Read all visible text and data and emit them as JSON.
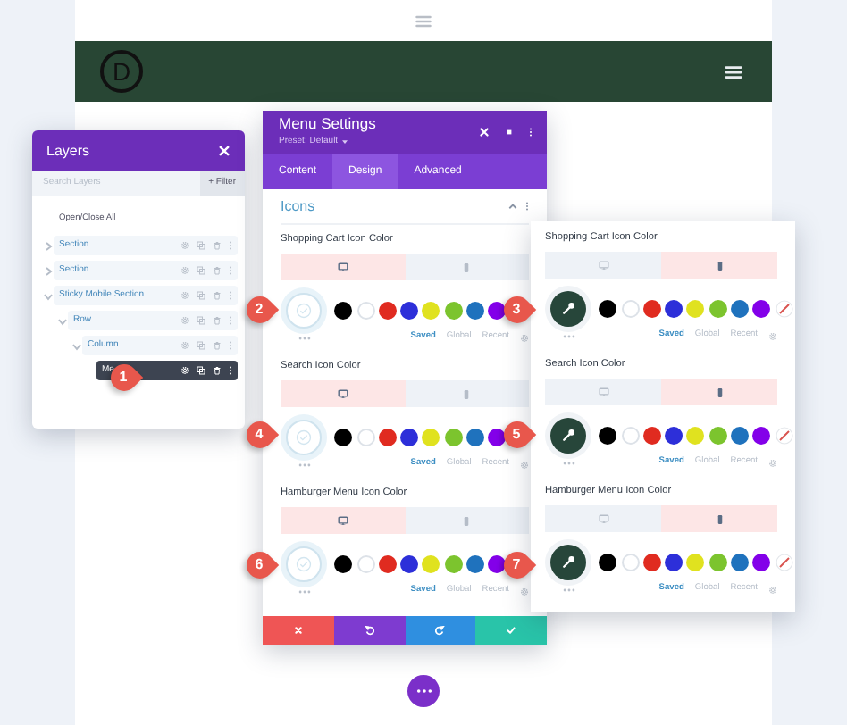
{
  "page": {
    "logo": "D"
  },
  "layers_panel": {
    "title": "Layers",
    "search": {
      "placeholder": "Search Layers"
    },
    "filter_button": "+ Filter",
    "toggle_all": "Open/Close All",
    "items": [
      {
        "label": "Section",
        "expanded": false,
        "selected": false
      },
      {
        "label": "Section",
        "expanded": false,
        "selected": false
      },
      {
        "label": "Sticky Mobile Section",
        "expanded": true,
        "selected": false,
        "children": [
          {
            "label": "Row",
            "expanded": true,
            "selected": false,
            "children": [
              {
                "label": "Column",
                "expanded": true,
                "selected": false,
                "children": [
                  {
                    "label": "Me",
                    "selected": true
                  }
                ]
              }
            ]
          }
        ]
      }
    ]
  },
  "settings_panel": {
    "title": "Menu Settings",
    "preset": "Preset: Default",
    "tabs": [
      {
        "label": "Content",
        "selected": false
      },
      {
        "label": "Design",
        "selected": true
      },
      {
        "label": "Advanced",
        "selected": false
      }
    ],
    "group": "Icons",
    "fields": [
      {
        "label": "Shopping Cart Icon Color",
        "devices": [
          {
            "kind": "desktop",
            "selected": true
          },
          {
            "kind": "phone",
            "selected": false
          }
        ],
        "swatches": [
          {
            "color": "#000000"
          },
          {
            "color": "#ffffff"
          },
          {
            "color": "#e02b20"
          },
          {
            "color": "#2d2fd9"
          },
          {
            "color": "#e0e21f"
          },
          {
            "color": "#7cc42e"
          },
          {
            "color": "#1f72bd"
          },
          {
            "color": "#8300e9"
          }
        ],
        "sources": [
          {
            "label": "Saved",
            "selected": true
          },
          {
            "label": "Global",
            "selected": false
          },
          {
            "label": "Recent",
            "selected": false
          }
        ]
      },
      {
        "label": "Search Icon Color",
        "devices": [
          {
            "kind": "desktop",
            "selected": true
          },
          {
            "kind": "phone",
            "selected": false
          }
        ],
        "swatches": [
          {
            "color": "#000000"
          },
          {
            "color": "#ffffff"
          },
          {
            "color": "#e02b20"
          },
          {
            "color": "#2d2fd9"
          },
          {
            "color": "#e0e21f"
          },
          {
            "color": "#7cc42e"
          },
          {
            "color": "#1f72bd"
          },
          {
            "color": "#8300e9"
          }
        ],
        "sources": [
          {
            "label": "Saved",
            "selected": true
          },
          {
            "label": "Global",
            "selected": false
          },
          {
            "label": "Recent",
            "selected": false
          }
        ]
      },
      {
        "label": "Hamburger Menu Icon Color",
        "devices": [
          {
            "kind": "desktop",
            "selected": true
          },
          {
            "kind": "phone",
            "selected": false
          }
        ],
        "swatches": [
          {
            "color": "#000000"
          },
          {
            "color": "#ffffff"
          },
          {
            "color": "#e02b20"
          },
          {
            "color": "#2d2fd9"
          },
          {
            "color": "#e0e21f"
          },
          {
            "color": "#7cc42e"
          },
          {
            "color": "#1f72bd"
          },
          {
            "color": "#8300e9"
          }
        ],
        "sources": [
          {
            "label": "Saved",
            "selected": true
          },
          {
            "label": "Global",
            "selected": false
          },
          {
            "label": "Recent",
            "selected": false
          }
        ]
      }
    ]
  },
  "mobile_panel": {
    "fields": [
      {
        "label": "Shopping Cart Icon Color",
        "devices": [
          {
            "kind": "desktop",
            "selected": false
          },
          {
            "kind": "phone",
            "selected": true
          }
        ],
        "color_set": true,
        "clear_swatch": true,
        "swatches": [
          {
            "color": "#000000"
          },
          {
            "color": "#ffffff"
          },
          {
            "color": "#e02b20"
          },
          {
            "color": "#2d2fd9"
          },
          {
            "color": "#e0e21f"
          },
          {
            "color": "#7cc42e"
          },
          {
            "color": "#1f72bd"
          },
          {
            "color": "#8300e9"
          }
        ],
        "sources": [
          {
            "label": "Saved",
            "selected": true
          },
          {
            "label": "Global",
            "selected": false
          },
          {
            "label": "Recent",
            "selected": false
          }
        ]
      },
      {
        "label": "Search Icon Color",
        "devices": [
          {
            "kind": "desktop",
            "selected": false
          },
          {
            "kind": "phone",
            "selected": true
          }
        ],
        "color_set": true,
        "clear_swatch": true,
        "swatches": [
          {
            "color": "#000000"
          },
          {
            "color": "#ffffff"
          },
          {
            "color": "#e02b20"
          },
          {
            "color": "#2d2fd9"
          },
          {
            "color": "#e0e21f"
          },
          {
            "color": "#7cc42e"
          },
          {
            "color": "#1f72bd"
          },
          {
            "color": "#8300e9"
          }
        ],
        "sources": [
          {
            "label": "Saved",
            "selected": true
          },
          {
            "label": "Global",
            "selected": false
          },
          {
            "label": "Recent",
            "selected": false
          }
        ]
      },
      {
        "label": "Hamburger Menu Icon Color",
        "devices": [
          {
            "kind": "desktop",
            "selected": false
          },
          {
            "kind": "phone",
            "selected": true
          }
        ],
        "color_set": true,
        "clear_swatch": true,
        "swatches": [
          {
            "color": "#000000"
          },
          {
            "color": "#ffffff"
          },
          {
            "color": "#e02b20"
          },
          {
            "color": "#2d2fd9"
          },
          {
            "color": "#e0e21f"
          },
          {
            "color": "#7cc42e"
          },
          {
            "color": "#1f72bd"
          },
          {
            "color": "#8300e9"
          }
        ],
        "sources": [
          {
            "label": "Saved",
            "selected": true
          },
          {
            "label": "Global",
            "selected": false
          },
          {
            "label": "Recent",
            "selected": false
          }
        ]
      }
    ]
  },
  "footer_buttons": [
    {
      "kind": "cancel"
    },
    {
      "kind": "undo"
    },
    {
      "kind": "redo"
    },
    {
      "kind": "save"
    }
  ],
  "callouts": [
    "1",
    "2",
    "3",
    "4",
    "5",
    "6",
    "7"
  ]
}
